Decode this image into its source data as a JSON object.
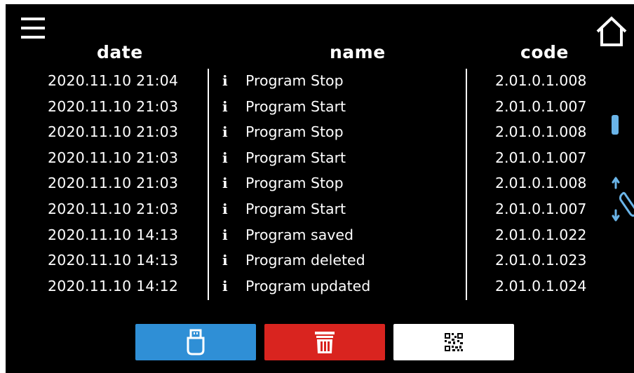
{
  "header": {
    "date": "date",
    "name": "name",
    "code": "code"
  },
  "rows": [
    {
      "date": "2020.11.10  21:04",
      "icon": "i",
      "name": "Program Stop",
      "code": "2.01.0.1.008"
    },
    {
      "date": "2020.11.10  21:03",
      "icon": "i",
      "name": "Program Start",
      "code": "2.01.0.1.007"
    },
    {
      "date": "2020.11.10  21:03",
      "icon": "i",
      "name": "Program Stop",
      "code": "2.01.0.1.008"
    },
    {
      "date": "2020.11.10  21:03",
      "icon": "i",
      "name": "Program Start",
      "code": "2.01.0.1.007"
    },
    {
      "date": "2020.11.10  21:03",
      "icon": "i",
      "name": "Program Stop",
      "code": "2.01.0.1.008"
    },
    {
      "date": "2020.11.10  21:03",
      "icon": "i",
      "name": "Program Start",
      "code": "2.01.0.1.007"
    },
    {
      "date": "2020.11.10  14:13",
      "icon": "i",
      "name": "Program saved",
      "code": "2.01.0.1.022"
    },
    {
      "date": "2020.11.10  14:13",
      "icon": "i",
      "name": "Program deleted",
      "code": "2.01.0.1.023"
    },
    {
      "date": "2020.11.10  14:12",
      "icon": "i",
      "name": "Program updated",
      "code": "2.01.0.1.024"
    }
  ],
  "icons": {
    "menu": "hamburger-menu-icon",
    "home": "home-icon",
    "row_info": "info-icon",
    "scroll": "scroll-drag-icon",
    "usb": "usb-drive-icon",
    "delete": "trash-icon",
    "qr": "qr-code-icon"
  },
  "colors": {
    "background": "#000000",
    "text": "#ffffff",
    "usb_button": "#2f8fd6",
    "delete_button": "#d9241f",
    "qr_button": "#ffffff",
    "scroll_thumb": "#6ab4e8"
  }
}
